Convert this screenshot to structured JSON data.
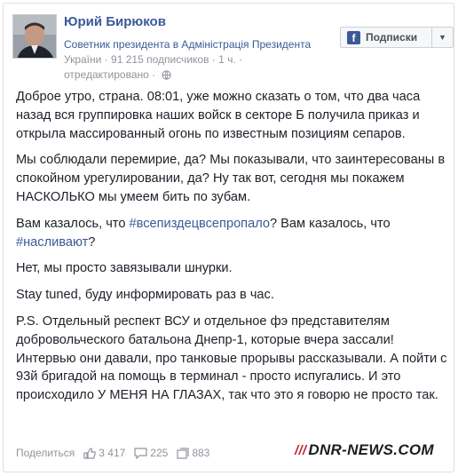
{
  "post": {
    "author": "Юрий Бирюков",
    "role": "Советник президента в Адміністрація Президента",
    "country": "України",
    "followers": "91 215 подписчиков",
    "time": "1 ч.",
    "edited": "отредактировано",
    "subscribe_label": "Подписки",
    "paragraphs": {
      "p1": "Доброе утро, страна. 08:01, уже можно сказать о том, что два часа назад вся группировка наших войск в секторе Б получила приказ и открыла массированный огонь по известным позициям сепаров.",
      "p2": "Мы соблюдали перемирие, да? Мы показывали, что заинтересованы в спокойном урегулировании, да? Ну так вот, сегодня мы покажем НАСКОЛЬКО мы умеем бить по зубам.",
      "p3_a": "Вам казалось, что ",
      "p3_tag1": "#всепиздецвсепропало",
      "p3_b": "? Вам казалось, что ",
      "p3_tag2": "#насливают",
      "p3_c": "?",
      "p4": "Нет, мы просто завязывали шнурки.",
      "p5": "Stay tuned, буду информировать раз в час.",
      "p6": "P.S. Отдельный респект ВСУ и отдельное фэ представителям добровольческого батальона Днепр-1, которые вчера зассали! Интервью они давали, про танковые прорывы рассказывали. А пойти с 93й бригадой на помощь в терминал - просто испугались. И это происходило У МЕНЯ НА ГЛАЗАХ, так что это я говорю не просто так."
    },
    "footer": {
      "share_label": "Поделиться",
      "likes": "3 417",
      "comments": "225",
      "shares": "883"
    },
    "watermark": "DNR-NEWS.COM",
    "colors": {
      "link": "#3b5998",
      "muted": "#90949c",
      "watermark_accent": "#c0282d"
    },
    "icons": [
      "facebook-icon",
      "chevron-down-icon",
      "globe-icon",
      "like-icon",
      "comment-icon",
      "share-icon"
    ]
  }
}
